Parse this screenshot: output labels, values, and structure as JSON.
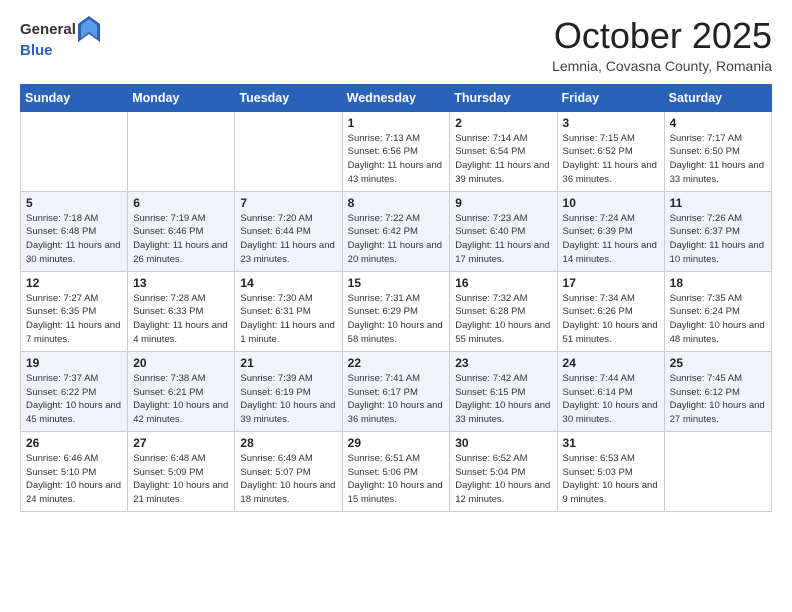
{
  "header": {
    "logo_general": "General",
    "logo_blue": "Blue",
    "month": "October 2025",
    "location": "Lemnia, Covasna County, Romania"
  },
  "days_of_week": [
    "Sunday",
    "Monday",
    "Tuesday",
    "Wednesday",
    "Thursday",
    "Friday",
    "Saturday"
  ],
  "weeks": [
    [
      {
        "day": "",
        "info": ""
      },
      {
        "day": "",
        "info": ""
      },
      {
        "day": "",
        "info": ""
      },
      {
        "day": "1",
        "info": "Sunrise: 7:13 AM\nSunset: 6:56 PM\nDaylight: 11 hours and 43 minutes."
      },
      {
        "day": "2",
        "info": "Sunrise: 7:14 AM\nSunset: 6:54 PM\nDaylight: 11 hours and 39 minutes."
      },
      {
        "day": "3",
        "info": "Sunrise: 7:15 AM\nSunset: 6:52 PM\nDaylight: 11 hours and 36 minutes."
      },
      {
        "day": "4",
        "info": "Sunrise: 7:17 AM\nSunset: 6:50 PM\nDaylight: 11 hours and 33 minutes."
      }
    ],
    [
      {
        "day": "5",
        "info": "Sunrise: 7:18 AM\nSunset: 6:48 PM\nDaylight: 11 hours and 30 minutes."
      },
      {
        "day": "6",
        "info": "Sunrise: 7:19 AM\nSunset: 6:46 PM\nDaylight: 11 hours and 26 minutes."
      },
      {
        "day": "7",
        "info": "Sunrise: 7:20 AM\nSunset: 6:44 PM\nDaylight: 11 hours and 23 minutes."
      },
      {
        "day": "8",
        "info": "Sunrise: 7:22 AM\nSunset: 6:42 PM\nDaylight: 11 hours and 20 minutes."
      },
      {
        "day": "9",
        "info": "Sunrise: 7:23 AM\nSunset: 6:40 PM\nDaylight: 11 hours and 17 minutes."
      },
      {
        "day": "10",
        "info": "Sunrise: 7:24 AM\nSunset: 6:39 PM\nDaylight: 11 hours and 14 minutes."
      },
      {
        "day": "11",
        "info": "Sunrise: 7:26 AM\nSunset: 6:37 PM\nDaylight: 11 hours and 10 minutes."
      }
    ],
    [
      {
        "day": "12",
        "info": "Sunrise: 7:27 AM\nSunset: 6:35 PM\nDaylight: 11 hours and 7 minutes."
      },
      {
        "day": "13",
        "info": "Sunrise: 7:28 AM\nSunset: 6:33 PM\nDaylight: 11 hours and 4 minutes."
      },
      {
        "day": "14",
        "info": "Sunrise: 7:30 AM\nSunset: 6:31 PM\nDaylight: 11 hours and 1 minute."
      },
      {
        "day": "15",
        "info": "Sunrise: 7:31 AM\nSunset: 6:29 PM\nDaylight: 10 hours and 58 minutes."
      },
      {
        "day": "16",
        "info": "Sunrise: 7:32 AM\nSunset: 6:28 PM\nDaylight: 10 hours and 55 minutes."
      },
      {
        "day": "17",
        "info": "Sunrise: 7:34 AM\nSunset: 6:26 PM\nDaylight: 10 hours and 51 minutes."
      },
      {
        "day": "18",
        "info": "Sunrise: 7:35 AM\nSunset: 6:24 PM\nDaylight: 10 hours and 48 minutes."
      }
    ],
    [
      {
        "day": "19",
        "info": "Sunrise: 7:37 AM\nSunset: 6:22 PM\nDaylight: 10 hours and 45 minutes."
      },
      {
        "day": "20",
        "info": "Sunrise: 7:38 AM\nSunset: 6:21 PM\nDaylight: 10 hours and 42 minutes."
      },
      {
        "day": "21",
        "info": "Sunrise: 7:39 AM\nSunset: 6:19 PM\nDaylight: 10 hours and 39 minutes."
      },
      {
        "day": "22",
        "info": "Sunrise: 7:41 AM\nSunset: 6:17 PM\nDaylight: 10 hours and 36 minutes."
      },
      {
        "day": "23",
        "info": "Sunrise: 7:42 AM\nSunset: 6:15 PM\nDaylight: 10 hours and 33 minutes."
      },
      {
        "day": "24",
        "info": "Sunrise: 7:44 AM\nSunset: 6:14 PM\nDaylight: 10 hours and 30 minutes."
      },
      {
        "day": "25",
        "info": "Sunrise: 7:45 AM\nSunset: 6:12 PM\nDaylight: 10 hours and 27 minutes."
      }
    ],
    [
      {
        "day": "26",
        "info": "Sunrise: 6:46 AM\nSunset: 5:10 PM\nDaylight: 10 hours and 24 minutes."
      },
      {
        "day": "27",
        "info": "Sunrise: 6:48 AM\nSunset: 5:09 PM\nDaylight: 10 hours and 21 minutes."
      },
      {
        "day": "28",
        "info": "Sunrise: 6:49 AM\nSunset: 5:07 PM\nDaylight: 10 hours and 18 minutes."
      },
      {
        "day": "29",
        "info": "Sunrise: 6:51 AM\nSunset: 5:06 PM\nDaylight: 10 hours and 15 minutes."
      },
      {
        "day": "30",
        "info": "Sunrise: 6:52 AM\nSunset: 5:04 PM\nDaylight: 10 hours and 12 minutes."
      },
      {
        "day": "31",
        "info": "Sunrise: 6:53 AM\nSunset: 5:03 PM\nDaylight: 10 hours and 9 minutes."
      },
      {
        "day": "",
        "info": ""
      }
    ]
  ]
}
